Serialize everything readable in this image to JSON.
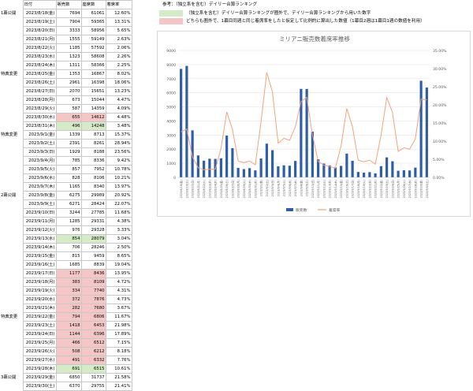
{
  "sheet": {
    "headers": [
      "日付",
      "販売数",
      "座席数",
      "着席率"
    ],
    "rows": [
      {
        "side": "1幕公開",
        "date": "2023/8/18(金)",
        "sales": "7694",
        "seats": "61061",
        "rate": "12.60%",
        "hl": ""
      },
      {
        "side": "",
        "date": "2023/8/19(土)",
        "sales": "7904",
        "seats": "59365",
        "rate": "13.31%",
        "hl": ""
      },
      {
        "side": "",
        "date": "2023/8/20(日)",
        "sales": "3333",
        "seats": "58956",
        "rate": "5.65%",
        "hl": ""
      },
      {
        "side": "",
        "date": "2023/8/21(月)",
        "sales": "1555",
        "seats": "59149",
        "rate": "2.63%",
        "hl": ""
      },
      {
        "side": "",
        "date": "2023/8/22(火)",
        "sales": "1185",
        "seats": "57592",
        "rate": "2.06%",
        "hl": ""
      },
      {
        "side": "",
        "date": "2023/8/23(水)",
        "sales": "1323",
        "seats": "58608",
        "rate": "2.26%",
        "hl": ""
      },
      {
        "side": "",
        "date": "2023/8/24(木)",
        "sales": "1311",
        "seats": "58366",
        "rate": "2.25%",
        "hl": ""
      },
      {
        "side": "特典変更",
        "date": "2023/8/25(金)",
        "sales": "1353",
        "seats": "16867",
        "rate": "8.02%",
        "hl": ""
      },
      {
        "side": "",
        "date": "2023/8/26(土)",
        "sales": "2961",
        "seats": "16398",
        "rate": "18.06%",
        "hl": ""
      },
      {
        "side": "",
        "date": "2023/8/27(日)",
        "sales": "2070",
        "seats": "15651",
        "rate": "13.23%",
        "hl": ""
      },
      {
        "side": "",
        "date": "2023/8/28(月)",
        "sales": "673",
        "seats": "15044",
        "rate": "4.47%",
        "hl": ""
      },
      {
        "side": "",
        "date": "2023/8/29(火)",
        "sales": "587",
        "seats": "14359",
        "rate": "4.09%",
        "hl": ""
      },
      {
        "side": "",
        "date": "2023/8/30(水)",
        "sales": "655",
        "seats": "14612",
        "rate": "4.48%",
        "hl": "pink"
      },
      {
        "side": "",
        "date": "2023/8/31(木)",
        "sales": "496",
        "seats": "14248",
        "rate": "3.48%",
        "hl": "green"
      },
      {
        "side": "特典変更",
        "date": "2023/9/1(金)",
        "sales": "1339",
        "seats": "8713",
        "rate": "15.37%",
        "hl": ""
      },
      {
        "side": "",
        "date": "2023/9/2(土)",
        "sales": "2391",
        "seats": "8261",
        "rate": "28.94%",
        "hl": ""
      },
      {
        "side": "",
        "date": "2023/9/3(日)",
        "sales": "1929",
        "seats": "8188",
        "rate": "23.56%",
        "hl": ""
      },
      {
        "side": "",
        "date": "2023/9/4(月)",
        "sales": "785",
        "seats": "8336",
        "rate": "9.42%",
        "hl": ""
      },
      {
        "side": "",
        "date": "2023/9/5(火)",
        "sales": "857",
        "seats": "7952",
        "rate": "10.78%",
        "hl": ""
      },
      {
        "side": "",
        "date": "2023/9/6(水)",
        "sales": "828",
        "seats": "8106",
        "rate": "10.21%",
        "hl": ""
      },
      {
        "side": "",
        "date": "2023/9/7(木)",
        "sales": "1165",
        "seats": "8340",
        "rate": "13.97%",
        "hl": ""
      },
      {
        "side": "2幕公開",
        "date": "2023/9/8(金)",
        "sales": "6275",
        "seats": "29989",
        "rate": "20.92%",
        "hl": ""
      },
      {
        "side": "",
        "date": "2023/9/9(土)",
        "sales": "6271",
        "seats": "28424",
        "rate": "22.07%",
        "hl": ""
      },
      {
        "side": "",
        "date": "2023/9/10(日)",
        "sales": "3244",
        "seats": "27785",
        "rate": "11.68%",
        "hl": ""
      },
      {
        "side": "",
        "date": "2023/9/11(月)",
        "sales": "1285",
        "seats": "29331",
        "rate": "4.38%",
        "hl": ""
      },
      {
        "side": "",
        "date": "2023/9/12(火)",
        "sales": "976",
        "seats": "29328",
        "rate": "3.33%",
        "hl": ""
      },
      {
        "side": "",
        "date": "2023/9/13(水)",
        "sales": "854",
        "seats": "28079",
        "rate": "3.04%",
        "hl": "green"
      },
      {
        "side": "",
        "date": "2023/9/14(木)",
        "sales": "706",
        "seats": "28246",
        "rate": "2.50%",
        "hl": ""
      },
      {
        "side": "",
        "date": "2023/9/15(金)",
        "sales": "815",
        "seats": "9459",
        "rate": "8.65%",
        "hl": ""
      },
      {
        "side": "",
        "date": "2023/9/16(土)",
        "sales": "1685",
        "seats": "8839",
        "rate": "19.04%",
        "hl": ""
      },
      {
        "side": "",
        "date": "2023/9/17(日)",
        "sales": "1177",
        "seats": "8436",
        "rate": "13.95%",
        "hl": "pink"
      },
      {
        "side": "",
        "date": "2023/9/18(月)",
        "sales": "383",
        "seats": "8109",
        "rate": "4.72%",
        "hl": "pink"
      },
      {
        "side": "",
        "date": "2023/9/19(火)",
        "sales": "334",
        "seats": "7740",
        "rate": "4.31%",
        "hl": "pink"
      },
      {
        "side": "",
        "date": "2023/9/20(水)",
        "sales": "372",
        "seats": "7876",
        "rate": "4.73%",
        "hl": "pink"
      },
      {
        "side": "",
        "date": "2023/9/21(木)",
        "sales": "282",
        "seats": "7680",
        "rate": "3.67%",
        "hl": "pink"
      },
      {
        "side": "特典変更",
        "date": "2023/9/22(金)",
        "sales": "794",
        "seats": "6806",
        "rate": "11.67%",
        "hl": "pink"
      },
      {
        "side": "",
        "date": "2023/9/23(土)",
        "sales": "1418",
        "seats": "6453",
        "rate": "21.98%",
        "hl": "pink"
      },
      {
        "side": "",
        "date": "2023/9/24(日)",
        "sales": "1144",
        "seats": "6396",
        "rate": "17.89%",
        "hl": "pink"
      },
      {
        "side": "",
        "date": "2023/9/25(月)",
        "sales": "466",
        "seats": "6512",
        "rate": "7.15%",
        "hl": "pink"
      },
      {
        "side": "",
        "date": "2023/9/26(火)",
        "sales": "508",
        "seats": "6212",
        "rate": "8.18%",
        "hl": "pink"
      },
      {
        "side": "",
        "date": "2023/9/27(水)",
        "sales": "491",
        "seats": "6332",
        "rate": "7.76%",
        "hl": "pink"
      },
      {
        "side": "",
        "date": "2023/9/28(木)",
        "sales": "691",
        "seats": "6515",
        "rate": "10.61%",
        "hl": "green"
      },
      {
        "side": "3幕公開",
        "date": "2023/9/29(金)",
        "sales": "6850",
        "seats": "31737",
        "rate": "21.58%",
        "hl": ""
      },
      {
        "side": "",
        "date": "2023/9/30(土)",
        "sales": "6370",
        "seats": "29755",
        "rate": "21.41%",
        "hl": ""
      }
    ]
  },
  "notes": {
    "title": "参考：（独立系を含む）デイリー合算ランキング",
    "green_label": "（独立系を含む）デイリー合算ランキングが圏外で、デイリー合算ランキングから用いた数字",
    "pink_label": "どちらも圏外で、1幕目同週と同じ着席率をしたと仮定して比例的に算出した数値（1幕目2週は1幕目1週の数値を利用）"
  },
  "colors": {
    "pink": "#f4c6c6",
    "green": "#d5ebc8",
    "bar": "#2e5eaa",
    "line": "#f2a27a"
  },
  "chart_data": {
    "type": "bar",
    "title": "ミリアニ販売数着席率推移",
    "categories": [
      "2023/8/18(金)",
      "2023/8/19(土)",
      "2023/8/20(日)",
      "2023/8/21(月)",
      "2023/8/22(火)",
      "2023/8/23(水)",
      "2023/8/24(木)",
      "2023/8/25(金)",
      "2023/8/26(土)",
      "2023/8/27(日)",
      "2023/8/28(月)",
      "2023/8/29(火)",
      "2023/8/30(水)",
      "2023/8/31(木)",
      "2023/9/1(金)",
      "2023/9/2(土)",
      "2023/9/3(日)",
      "2023/9/4(月)",
      "2023/9/5(火)",
      "2023/9/6(水)",
      "2023/9/7(木)",
      "2023/9/8(金)",
      "2023/9/9(土)",
      "2023/9/10(日)",
      "2023/9/11(月)",
      "2023/9/12(火)",
      "2023/9/13(水)",
      "2023/9/14(木)",
      "2023/9/15(金)",
      "2023/9/16(土)",
      "2023/9/17(日)",
      "2023/9/18(月)",
      "2023/9/19(火)",
      "2023/9/20(水)",
      "2023/9/21(木)",
      "2023/9/22(金)",
      "2023/9/23(土)",
      "2023/9/24(日)",
      "2023/9/25(月)",
      "2023/9/26(火)",
      "2023/9/27(水)",
      "2023/9/28(木)",
      "2023/9/29(金)",
      "2023/9/30(土)"
    ],
    "series": [
      {
        "name": "販売数",
        "type": "bar",
        "axis": "left",
        "values": [
          7694,
          7904,
          3333,
          1555,
          1185,
          1323,
          1311,
          1353,
          2961,
          2070,
          673,
          587,
          655,
          496,
          1339,
          2391,
          1929,
          785,
          857,
          828,
          1165,
          6275,
          6271,
          3244,
          1285,
          976,
          854,
          706,
          815,
          1685,
          1177,
          383,
          334,
          372,
          282,
          794,
          1418,
          1144,
          466,
          508,
          491,
          691,
          6850,
          6370
        ]
      },
      {
        "name": "着席率",
        "type": "line",
        "axis": "right",
        "values": [
          12.6,
          13.31,
          5.65,
          2.63,
          2.06,
          2.26,
          2.25,
          8.02,
          18.06,
          13.23,
          4.47,
          4.09,
          4.48,
          3.48,
          15.37,
          28.94,
          23.56,
          9.42,
          10.78,
          10.21,
          13.97,
          20.92,
          22.07,
          11.68,
          4.38,
          3.33,
          3.04,
          2.5,
          8.65,
          19.04,
          13.95,
          4.72,
          4.31,
          4.73,
          3.67,
          11.67,
          21.98,
          17.89,
          7.15,
          8.18,
          7.76,
          10.61,
          21.58,
          21.41
        ]
      }
    ],
    "left_ticks": [
      "9000",
      "8000",
      "7000",
      "6000",
      "5000",
      "4000",
      "3000",
      "2000",
      "1000",
      "0"
    ],
    "right_ticks": [
      "35.00%",
      "30.00%",
      "25.00%",
      "20.00%",
      "15.00%",
      "10.00%",
      "5.00%",
      "0.00%"
    ],
    "ylim_left": [
      0,
      9000
    ],
    "ylim_right": [
      0,
      35
    ],
    "legend_position": "bottom"
  }
}
